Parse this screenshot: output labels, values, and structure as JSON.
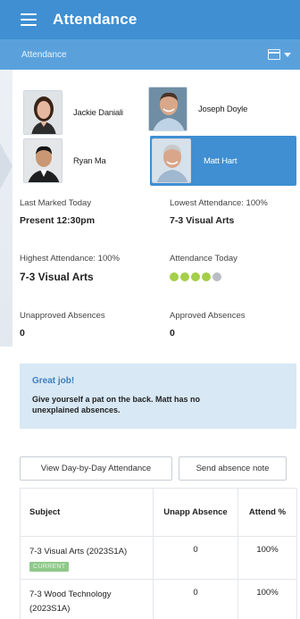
{
  "app": {
    "title": "Attendance"
  },
  "subbar": {
    "title": "Attendance"
  },
  "students": [
    {
      "name": "Jackie Daniali",
      "selected": false
    },
    {
      "name": "Joseph Doyle",
      "selected": false
    },
    {
      "name": "Ryan Ma",
      "selected": false
    },
    {
      "name": "Matt Hart",
      "selected": true
    }
  ],
  "stats": {
    "last_marked_label": "Last Marked Today",
    "last_marked_value": "Present 12:30pm",
    "lowest_label": "Lowest Attendance: 100%",
    "lowest_value": "7-3 Visual Arts",
    "highest_label": "Highest Attendance: 100%",
    "highest_value": "7-3 Visual Arts",
    "today_label": "Attendance Today",
    "today_dots": [
      "present",
      "present",
      "present",
      "present",
      "not-marked"
    ],
    "unapproved_label": "Unapproved Absences",
    "unapproved_value": "0",
    "approved_label": "Approved Absences",
    "approved_value": "0"
  },
  "alert": {
    "title": "Great job!",
    "body": "Give yourself a pat on the back. Matt has no unexplained absences."
  },
  "buttons": {
    "day_by_day": "View Day-by-Day Attendance",
    "send_note": "Send absence note"
  },
  "table": {
    "headers": {
      "subject": "Subject",
      "unapproved": "Unapp Absence",
      "attend": "Attend %"
    },
    "rows": [
      {
        "subject": "7-3 Visual Arts (2023S1A)",
        "badge": "CURRENT",
        "unapproved": "0",
        "attend": "100%"
      },
      {
        "subject": "7-3 Wood Technology (2023S1A)",
        "badge": "",
        "unapproved": "0",
        "attend": "100%"
      }
    ]
  },
  "colors": {
    "primary": "#3f8fd2",
    "subbar": "#5aa1dc",
    "alert_bg": "#d8e8f5",
    "dot_present": "#a4cf4a",
    "dot_unmarked": "#b9bec4",
    "badge": "#8fc98a"
  }
}
